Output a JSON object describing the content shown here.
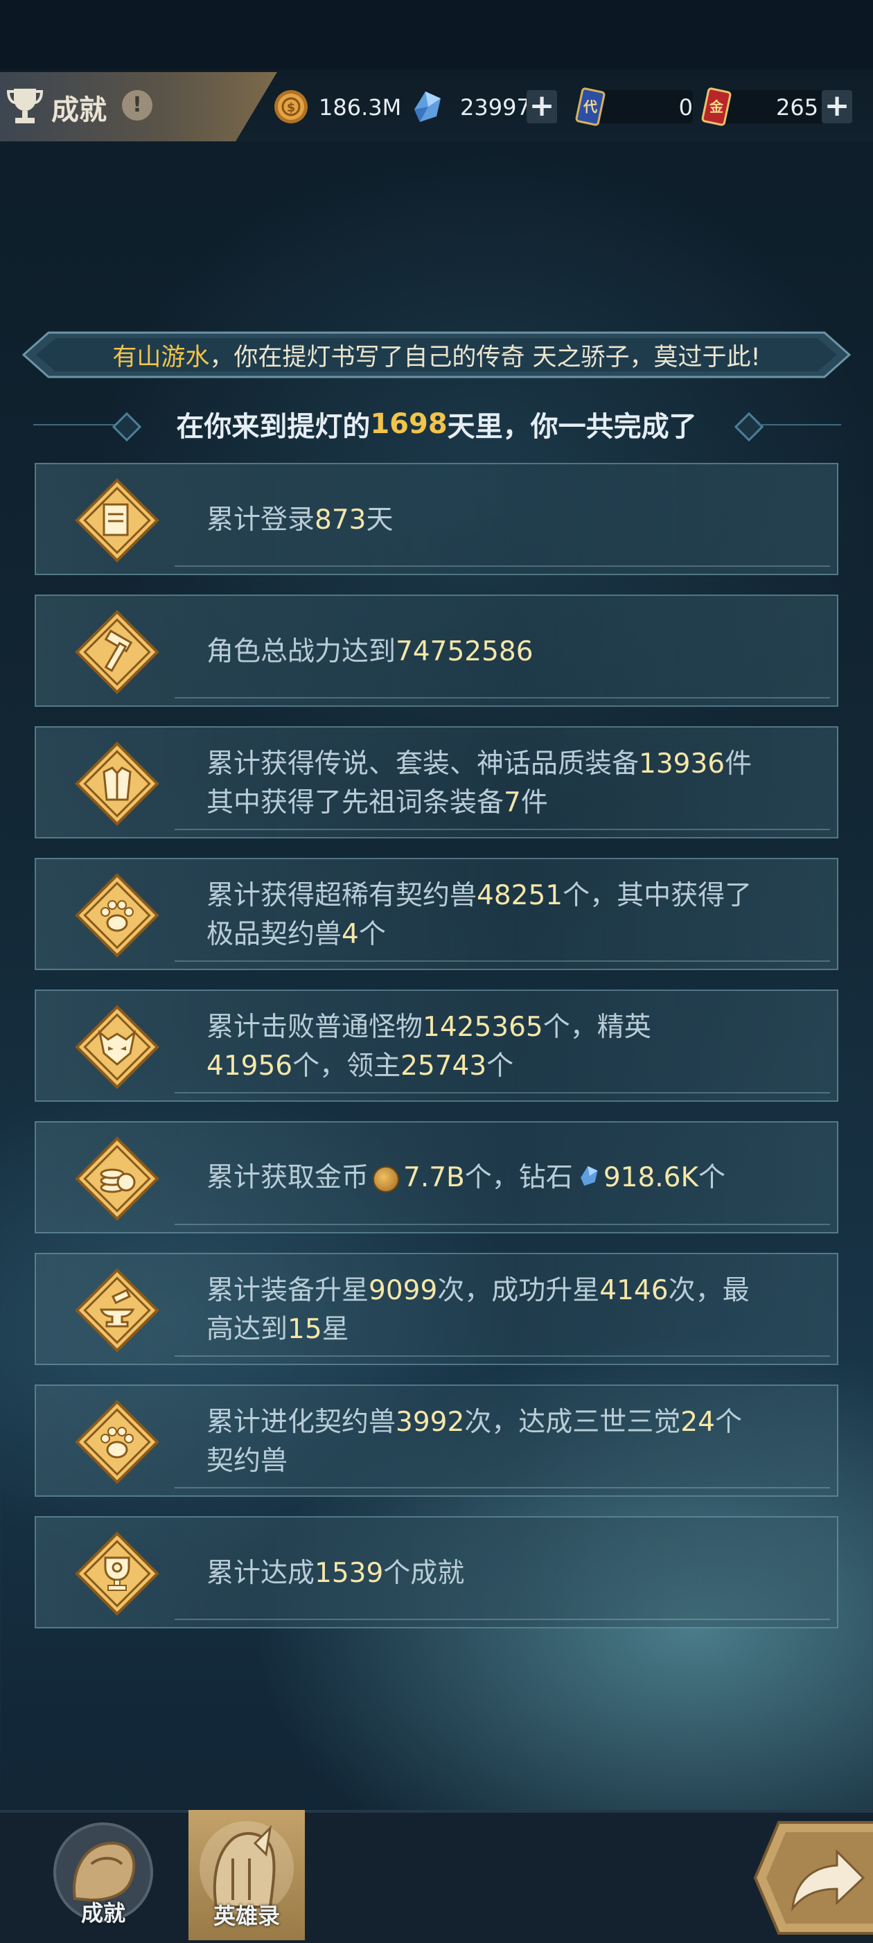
{
  "header": {
    "title": "成就",
    "help_symbol": "!",
    "resources": [
      {
        "name": "gold-coin",
        "value": "186.3M"
      },
      {
        "name": "diamond",
        "value": "23997"
      },
      {
        "name": "card-token",
        "value": "0"
      },
      {
        "name": "gold-card",
        "value": "265"
      }
    ],
    "card_token_glyph": "代",
    "gold_card_glyph": "金",
    "plus_symbol": "+"
  },
  "banner": {
    "name_highlight": "有山游水",
    "text": "，你在提灯书写了自己的传奇 天之骄子，莫过于此!"
  },
  "subhead": {
    "prefix": "在你来到提灯的",
    "days": "1698",
    "suffix": "天里，你一共完成了"
  },
  "stats": [
    {
      "icon": "login-scroll-icon",
      "parts": [
        "累计登录",
        "873",
        "天"
      ]
    },
    {
      "icon": "combat-power-icon",
      "parts": [
        "角色总战力达到",
        "74752586"
      ]
    },
    {
      "icon": "armor-icon",
      "parts": [
        "累计获得传说、套装、神话品质装备",
        "13936",
        "件"
      ],
      "line2": [
        "其中获得了先祖词条装备",
        "7",
        "件"
      ]
    },
    {
      "icon": "paw-icon",
      "parts": [
        "累计获得超稀有契约兽",
        "48251",
        "个，其中获得了"
      ],
      "line2": [
        "极品契约兽",
        "4",
        "个"
      ]
    },
    {
      "icon": "demon-mask-icon",
      "parts": [
        "累计击败普通怪物",
        "1425365",
        "个，精英"
      ],
      "line2": [
        "",
        "41956",
        "个，领主",
        "25743",
        "个"
      ]
    },
    {
      "icon": "coins-icon",
      "parts": [
        "累计获取金币",
        "7.7B",
        "个，钻石",
        "918.6K",
        "个"
      ]
    },
    {
      "icon": "anvil-icon",
      "parts": [
        "累计装备升星",
        "9099",
        "次，成功升星",
        "4146",
        "次，最"
      ],
      "line2": [
        "高达到",
        "15",
        "星"
      ]
    },
    {
      "icon": "paw-icon",
      "parts": [
        "累计进化契约兽",
        "3992",
        "次，达成三世三觉",
        "24",
        "个"
      ],
      "line2": [
        "契约兽"
      ]
    },
    {
      "icon": "trophy-icon",
      "parts": [
        "累计达成",
        "1539",
        "个成就"
      ]
    }
  ],
  "bottom_tabs": [
    {
      "label": "成就",
      "active": false
    },
    {
      "label": "英雄录",
      "active": true
    }
  ],
  "colors": {
    "accent": "#f3c44a",
    "number": "#f5e7a8",
    "text": "#b9cdd8"
  }
}
